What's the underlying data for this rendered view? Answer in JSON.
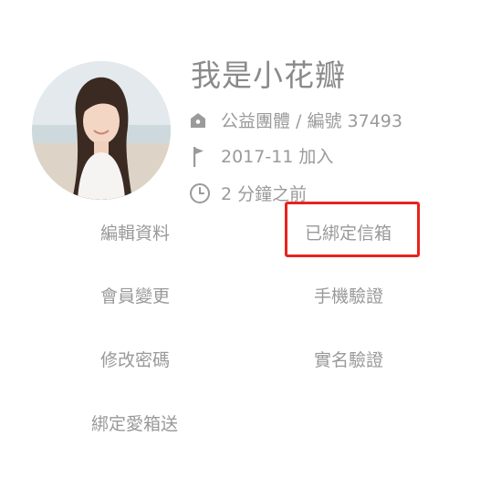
{
  "profile": {
    "name": "我是小花瓣",
    "org": "公益團體 / 編號 37493",
    "joined": "2017-11 加入",
    "last_active": "2 分鐘之前"
  },
  "icons": {
    "org": "house-badge-icon",
    "joined": "flag-icon",
    "last_active": "clock-icon"
  },
  "menu": {
    "edit_profile": "編輯資料",
    "bind_email": "已綁定信箱",
    "member_change": "會員變更",
    "phone_verify": "手機驗證",
    "change_password": "修改密碼",
    "realname_verify": "實名驗證",
    "bind_aixiangsong": "綁定愛箱送"
  },
  "colors": {
    "text": "#8c8c8c",
    "highlight": "#e8231d"
  }
}
